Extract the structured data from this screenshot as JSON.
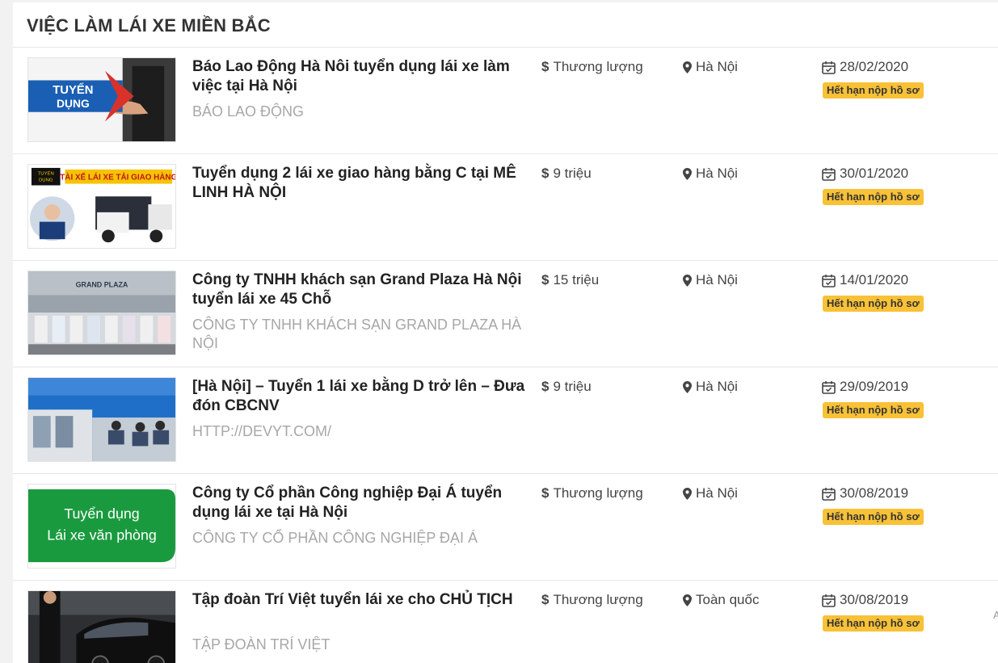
{
  "section": {
    "title": "VIỆC LÀM LÁI XE MIỀN BẮC"
  },
  "jobs": [
    {
      "title": "Báo Lao Động Hà Nôi tuyển dụng lái xe làm việc tại Hà Nội",
      "company": "BÁO LAO ĐỘNG",
      "salary": "Thương lượng",
      "location": "Hà Nội",
      "date": "28/02/2020",
      "status": "Hết hạn nộp hồ sơ",
      "thumb": {
        "line1": "TUYỂN",
        "line2": "DỤNG"
      }
    },
    {
      "title": "Tuyển dụng 2 lái xe giao hàng bằng C tại MÊ LINH HÀ NỘI",
      "company": "",
      "salary": "9 triệu",
      "location": "Hà Nội",
      "date": "30/01/2020",
      "status": "Hết hạn nộp hồ sơ",
      "thumb": {
        "tag1": "TUYỂN",
        "tag2": "DỤNG",
        "banner": "TÀI XẾ LÁI XE TẢI GIAO HÀNG"
      }
    },
    {
      "title": "Công ty TNHH khách sạn Grand Plaza Hà Nội tuyển lái xe 45 Chỗ",
      "company": "CÔNG TY TNHH KHÁCH SẠN GRAND PLAZA HÀ NỘI",
      "salary": "15 triệu",
      "location": "Hà Nội",
      "date": "14/01/2020",
      "status": "Hết hạn nộp hồ sơ",
      "thumb": {
        "sign": "GRAND PLAZA"
      }
    },
    {
      "title": "[Hà Nội] – Tuyển 1 lái xe bằng D trở lên – Đưa đón CBCNV",
      "company": "HTTP://DEVYT.COM/",
      "salary": "9 triệu",
      "location": "Hà Nội",
      "date": "29/09/2019",
      "status": "Hết hạn nộp hồ sơ"
    },
    {
      "title": "Công ty Cổ phần Công nghiệp Đại Á tuyển dụng lái xe tại Hà Nội",
      "company": "CÔNG TY CỔ PHẦN CÔNG NGHIỆP ĐẠI Á",
      "salary": "Thương lượng",
      "location": "Hà Nội",
      "date": "30/08/2019",
      "status": "Hết hạn nộp hồ sơ",
      "thumb": {
        "line1": "Tuyển dụng",
        "line2": "Lái xe văn phòng"
      }
    },
    {
      "title": "Tập đoàn Trí Việt tuyển lái xe cho CHỦ TỊCH",
      "company": "TẬP ĐOÀN TRÍ VIỆT",
      "salary": "Thương lượng",
      "location": "Toàn quốc",
      "date": "30/08/2019",
      "status": "Hết hạn nộp hồ sơ"
    }
  ],
  "edge": {
    "char": "A"
  },
  "colors": {
    "badge": "#f8c136",
    "company": "#a7a7a7",
    "accent_blue": "#1e6fc4",
    "accent_green": "#1a9a3f"
  },
  "icons": {
    "salary": "dollar-icon",
    "location": "map-pin-icon",
    "date": "calendar-icon"
  }
}
